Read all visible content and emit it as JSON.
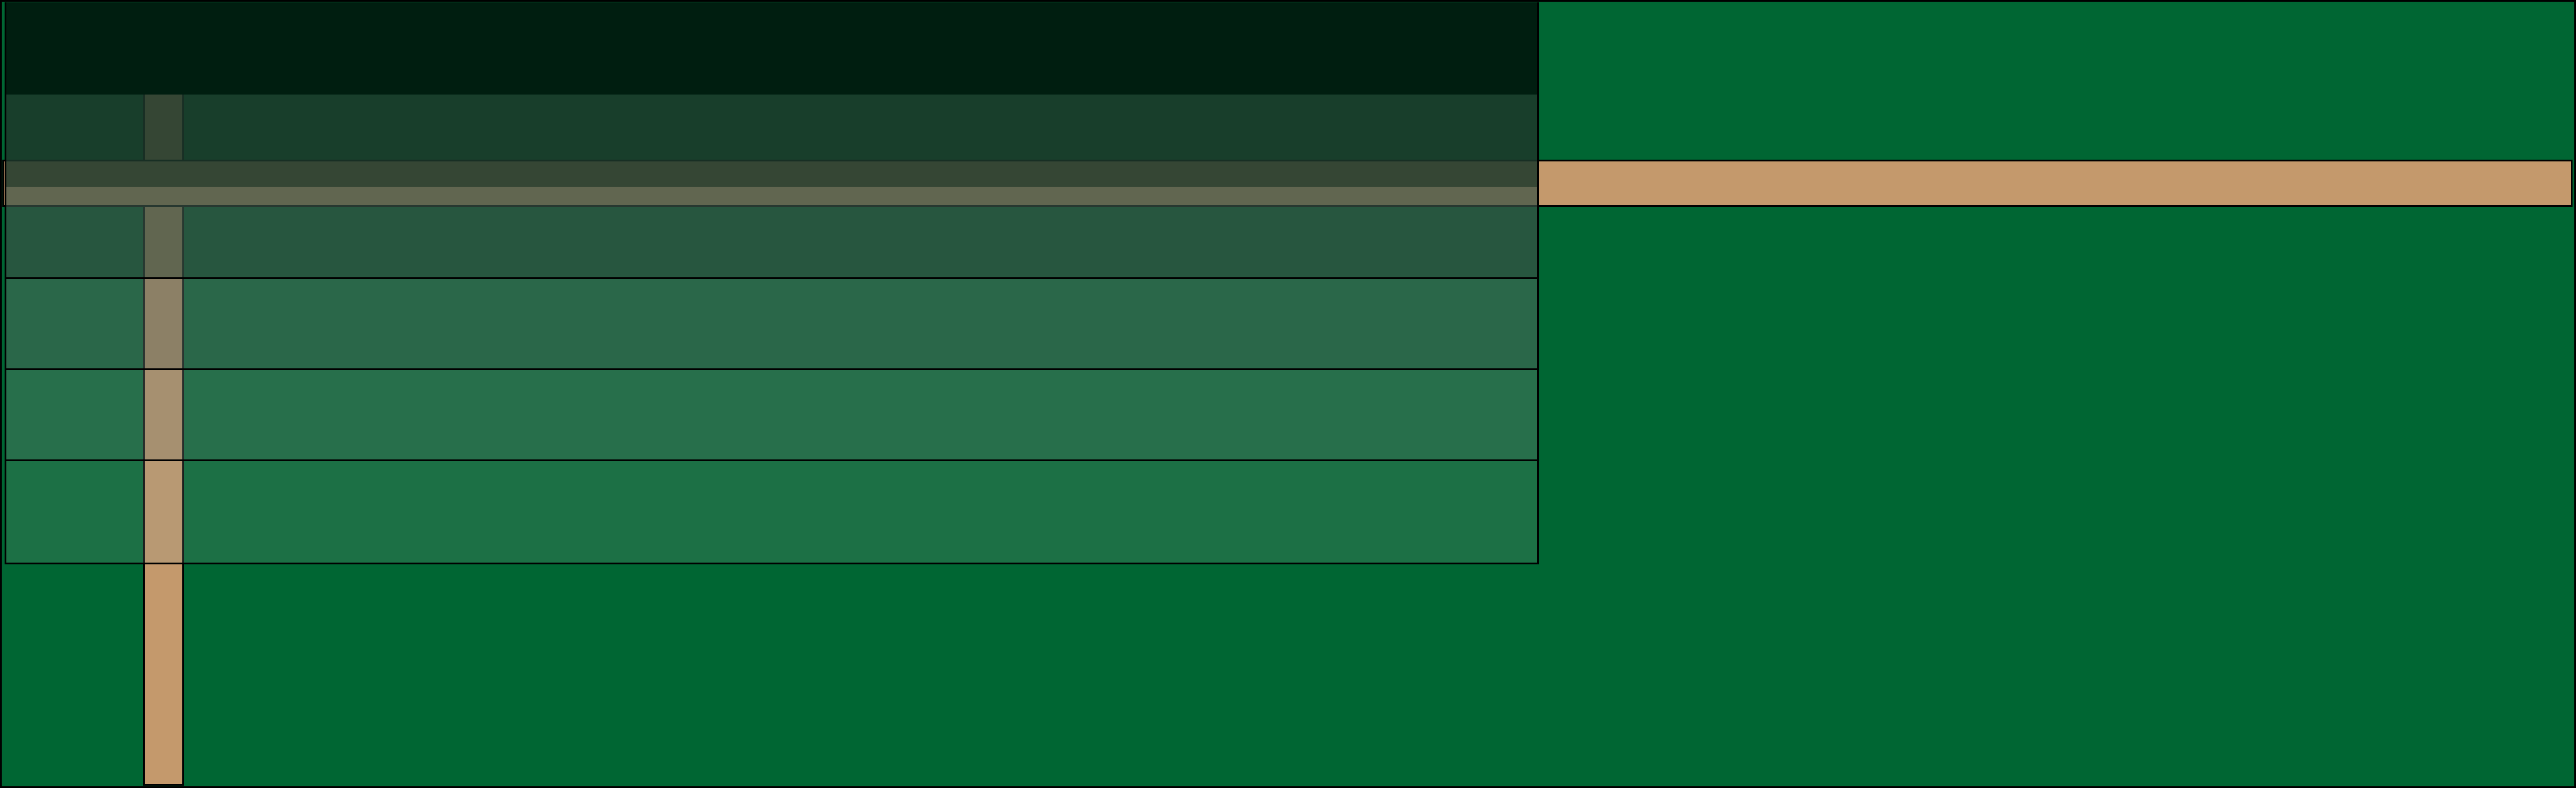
{
  "colors": {
    "background": "#006633",
    "bar_fill": "#C4996C",
    "border": "#000000",
    "overlay_base": "#001E10"
  },
  "overlay_bands": [
    {
      "opacity": 1.0
    },
    {
      "opacity": 0.85
    },
    {
      "opacity": 0.7
    },
    {
      "opacity": 0.5
    },
    {
      "opacity": 0.35
    },
    {
      "opacity": 0.2
    }
  ]
}
